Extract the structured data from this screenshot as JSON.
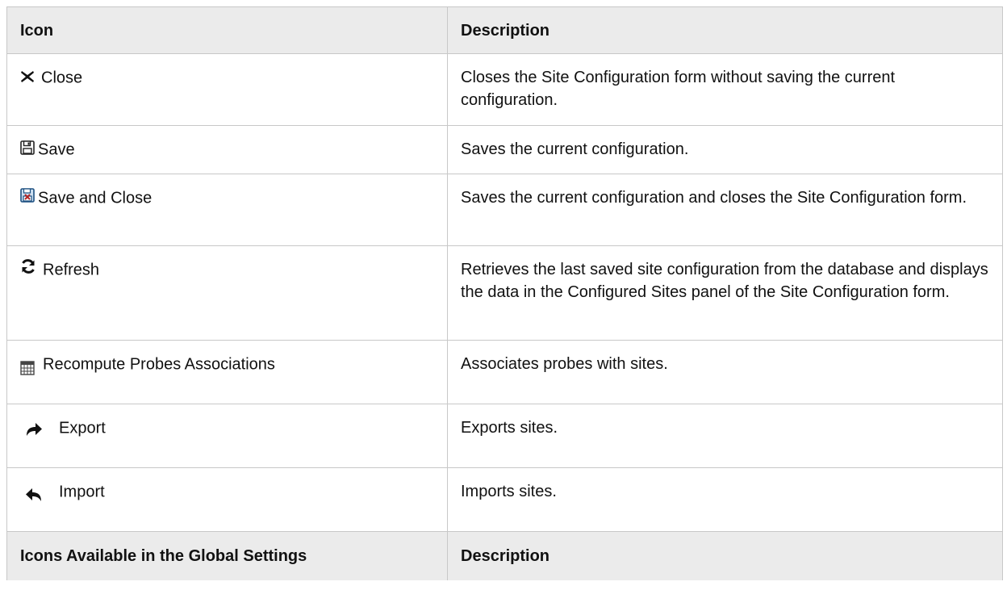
{
  "table": {
    "header": {
      "col1": "Icon",
      "col2": "Description"
    },
    "rows": [
      {
        "icon": "close-icon",
        "label": "Close",
        "description": "Closes the Site Configuration form without saving the current configuration.",
        "is_link": false
      },
      {
        "icon": "save-icon",
        "label": "Save",
        "description": "Saves the current configuration.",
        "is_link": false
      },
      {
        "icon": "save-and-close-icon",
        "label": "Save and Close",
        "description": "Saves the current configuration and closes the Site Configuration form.",
        "is_link": false
      },
      {
        "icon": "refresh-icon",
        "label": "Refresh",
        "description": "Retrieves the last saved site configuration from the database and displays the data in the Configured Sites panel of the Site Configuration form.",
        "is_link": false
      },
      {
        "icon": "calculator-icon",
        "label": "Recompute Probes Associations",
        "description": "Associates probes with sites.",
        "is_link": true
      },
      {
        "icon": "export-arrow-icon",
        "label": "Export",
        "description": "Exports sites.",
        "is_link": true
      },
      {
        "icon": "import-arrow-icon",
        "label": "Import",
        "description": "Imports sites.",
        "is_link": true
      }
    ],
    "subheader": {
      "col1": "Icons Available in the Global Settings",
      "col2": "Description"
    }
  },
  "colors": {
    "link": "#1aa390",
    "header_bg": "#ebebeb",
    "border": "#c8c8c8"
  }
}
